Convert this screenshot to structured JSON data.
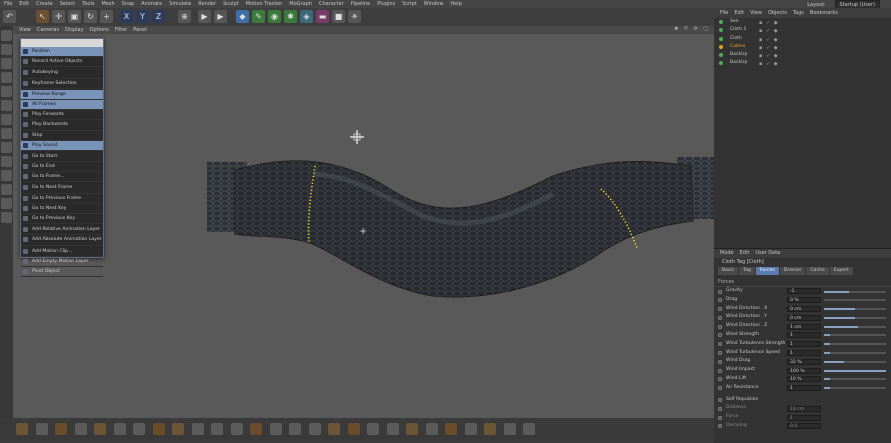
{
  "menubar": {
    "items": [
      "File",
      "Edit",
      "Create",
      "Select",
      "Tools",
      "Mesh",
      "Snap",
      "Animate",
      "Simulate",
      "Render",
      "Sculpt",
      "Motion Tracker",
      "MoGraph",
      "Character",
      "Pipeline",
      "Plugins",
      "Script",
      "Window",
      "Help"
    ],
    "layout_label": "Layout:",
    "layout_value": "Startup (User)"
  },
  "viewport": {
    "menu": [
      "View",
      "Cameras",
      "Display",
      "Options",
      "Filter",
      "Panel"
    ]
  },
  "popup_menu": {
    "items": [
      {
        "label": "Position",
        "highlight": true,
        "sep": false
      },
      {
        "label": "Record Active Objects",
        "highlight": false,
        "sep": false
      },
      {
        "label": "Autokeying",
        "highlight": false,
        "sep": true
      },
      {
        "label": "Keyframe Selection",
        "highlight": false,
        "sep": false
      },
      {
        "label": "Preview Range",
        "highlight": true,
        "sep": true
      },
      {
        "label": "All Frames",
        "highlight": true,
        "sep": false
      },
      {
        "label": "Play Forwards",
        "highlight": false,
        "sep": false
      },
      {
        "label": "Play Backwards",
        "highlight": false,
        "sep": false
      },
      {
        "label": "Stop",
        "highlight": false,
        "sep": false
      },
      {
        "label": "Play Sound",
        "highlight": true,
        "sep": false
      },
      {
        "label": "Go to Start",
        "highlight": false,
        "sep": true
      },
      {
        "label": "Go to End",
        "highlight": false,
        "sep": false
      },
      {
        "label": "Go to Frame...",
        "highlight": false,
        "sep": false
      },
      {
        "label": "Go to Next Frame",
        "highlight": false,
        "sep": true
      },
      {
        "label": "Go to Previous Frame",
        "highlight": false,
        "sep": false
      },
      {
        "label": "Go to Next Key",
        "highlight": false,
        "sep": false
      },
      {
        "label": "Go to Previous Key",
        "highlight": false,
        "sep": false
      },
      {
        "label": "Add Relative Animation Layer",
        "highlight": false,
        "sep": true
      },
      {
        "label": "Add Absolute Animation Layer",
        "highlight": false,
        "sep": false
      },
      {
        "label": "Add Motion Clip...",
        "highlight": false,
        "sep": true
      },
      {
        "label": "Add Empty Motion Layer",
        "highlight": false,
        "sep": false
      },
      {
        "label": "Pivot Object",
        "highlight": false,
        "sep": false
      }
    ]
  },
  "object_manager": {
    "menu": [
      "File",
      "Edit",
      "View",
      "Objects",
      "Tags",
      "Bookmarks"
    ],
    "objects": [
      {
        "name": "Sen",
        "color": "#4caf50"
      },
      {
        "name": "Cloth.1",
        "color": "#4caf50"
      },
      {
        "name": "Cloth",
        "color": "#4caf50"
      },
      {
        "name": "Cables",
        "color": "#e0a020"
      },
      {
        "name": "BackUp",
        "color": "#4caf50"
      },
      {
        "name": "BackUp",
        "color": "#4caf50"
      }
    ]
  },
  "attributes": {
    "menu": [
      "Mode",
      "Edit",
      "User Data"
    ],
    "title": "Cloth Tag [Cloth]",
    "tabs": [
      {
        "label": "Basic",
        "active": false
      },
      {
        "label": "Tag",
        "active": false
      },
      {
        "label": "Forces",
        "active": true
      },
      {
        "label": "Dresser",
        "active": false
      },
      {
        "label": "Cache",
        "active": false
      },
      {
        "label": "Expert",
        "active": false
      }
    ],
    "section": "Forces",
    "params": [
      {
        "label": "Gravity",
        "value": "-1",
        "fill": 0.4
      },
      {
        "label": "Drag",
        "value": "0 %",
        "fill": 0
      },
      {
        "label": "Wind Direction . X",
        "value": "0 cm",
        "fill": 0.5
      },
      {
        "label": "Wind Direction . Y",
        "value": "0 cm",
        "fill": 0.5
      },
      {
        "label": "Wind Direction . Z",
        "value": "1 cm",
        "fill": 0.55
      },
      {
        "label": "Wind Strength",
        "value": "1",
        "fill": 0.1
      },
      {
        "label": "Wind Turbulence Strength",
        "value": "1",
        "fill": 0.1
      },
      {
        "label": "Wind Turbulence Speed",
        "value": "1",
        "fill": 0.1
      },
      {
        "label": "Wind Drag",
        "value": "32 %",
        "fill": 0.32
      },
      {
        "label": "Wind Impact",
        "value": "100 %",
        "fill": 1
      },
      {
        "label": "Wind Lift",
        "value": "10 %",
        "fill": 0.1
      },
      {
        "label": "Air Resistance",
        "value": "1",
        "fill": 0.1
      }
    ],
    "extra": [
      {
        "label": "Self Repulsion",
        "value": ""
      },
      {
        "label": "Distance",
        "value": "10 cm"
      },
      {
        "label": "Force",
        "value": "1"
      },
      {
        "label": "Damping",
        "value": "0.5"
      }
    ]
  }
}
